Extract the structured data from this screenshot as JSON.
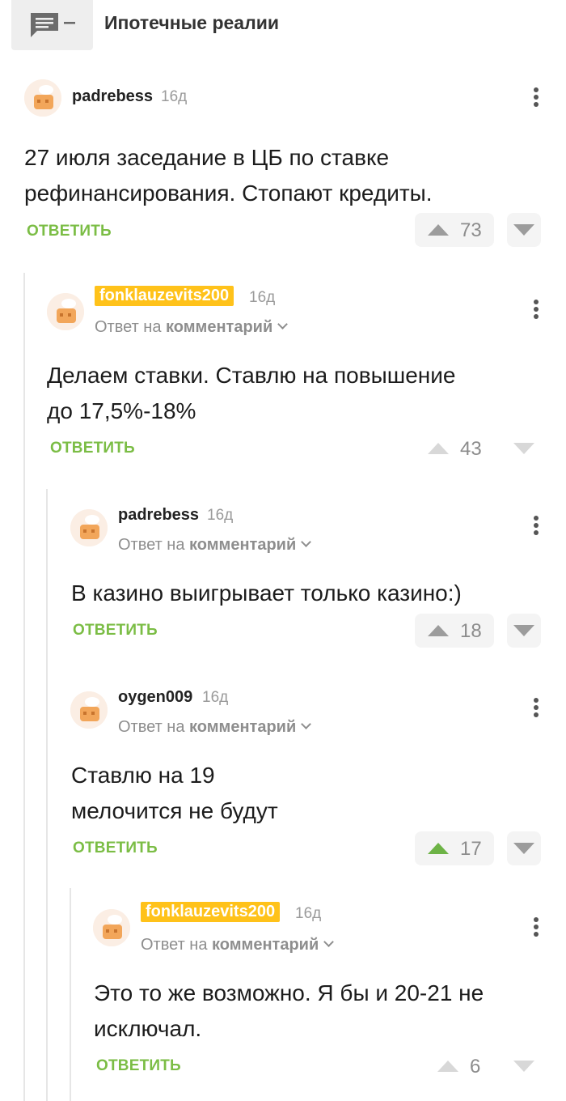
{
  "header": {
    "story_title": "Ипотечные реалии",
    "story_icon": "comment-list-icon"
  },
  "labels": {
    "reply_prefix": "Ответ на",
    "reply_target": "комментарий",
    "reply_button": "ОТВЕТИТЬ"
  },
  "comments": [
    {
      "author": "padrebess",
      "time": "16д",
      "lines": [
        "27 июля заседание в ЦБ по ставке",
        "рефинансирования. Стопают кредиты."
      ],
      "rating": "73"
    },
    {
      "author": "fonklauzevits200",
      "time": "16д",
      "lines": [
        "Делаем ставки. Ставлю на повышение",
        "до 17,5%-18%"
      ],
      "rating": "43"
    },
    {
      "author": "padrebess",
      "time": "16д",
      "lines": [
        "В казино выигрывает только казино:)"
      ],
      "rating": "18"
    },
    {
      "author": "oygen009",
      "time": "16д",
      "lines": [
        "Ставлю на 19",
        "мелочится не будут"
      ],
      "rating": "17"
    },
    {
      "author": "fonklauzevits200",
      "time": "16д",
      "lines": [
        "Это то же возможно. Я бы и 20-21 не",
        "исключал."
      ],
      "rating": "6"
    }
  ],
  "colors": {
    "accent_green": "#7bbd45",
    "highlight_badge": "#ffc21a",
    "upvoted": "#6db346"
  }
}
